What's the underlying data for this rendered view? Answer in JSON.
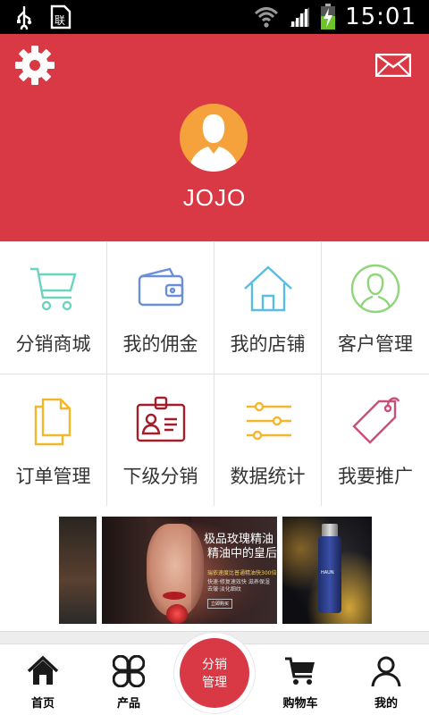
{
  "status_bar": {
    "time": "15:01",
    "icons": [
      "usb-icon",
      "sim-notification-icon",
      "wifi-icon",
      "signal-icon",
      "battery-charging-icon"
    ]
  },
  "header": {
    "settings_icon": "gear-icon",
    "message_icon": "envelope-icon",
    "avatar_icon": "user-avatar-icon",
    "username": "JOJO",
    "background_color": "#d83944"
  },
  "menu": [
    {
      "label": "分销商城",
      "icon": "shopping-cart-icon",
      "color": "#6cd3c0"
    },
    {
      "label": "我的佣金",
      "icon": "wallet-icon",
      "color": "#6b8fd6"
    },
    {
      "label": "我的店铺",
      "icon": "home-icon",
      "color": "#58bde0"
    },
    {
      "label": "客户管理",
      "icon": "person-circle-icon",
      "color": "#8fd67a"
    },
    {
      "label": "订单管理",
      "icon": "documents-icon",
      "color": "#f2b72a"
    },
    {
      "label": "下级分销",
      "icon": "id-badge-icon",
      "color": "#a11e2a"
    },
    {
      "label": "数据统计",
      "icon": "sliders-icon",
      "color": "#f2b72a"
    },
    {
      "label": "我要推广",
      "icon": "price-tag-icon",
      "color": "#c94f7a"
    }
  ],
  "banner": {
    "headline_line1": "极品玫瑰精油",
    "headline_line2": "精油中的皇后",
    "detail_line1": "瑞依速度比普通精油快300倍",
    "detail_line2": "快速·修复速效快 滋养保湿",
    "detail_line3": "去皱·淡化细纹",
    "button_text": "立即购买",
    "brand": "HAUN"
  },
  "tabbar": {
    "tabs": [
      {
        "label": "首页",
        "icon": "home-icon"
      },
      {
        "label": "产品",
        "icon": "grid-circles-icon"
      },
      {
        "label": "购物车",
        "icon": "cart-icon"
      },
      {
        "label": "我的",
        "icon": "person-icon"
      }
    ],
    "center_line1": "分销",
    "center_line2": "管理",
    "accent": "#d83944"
  }
}
